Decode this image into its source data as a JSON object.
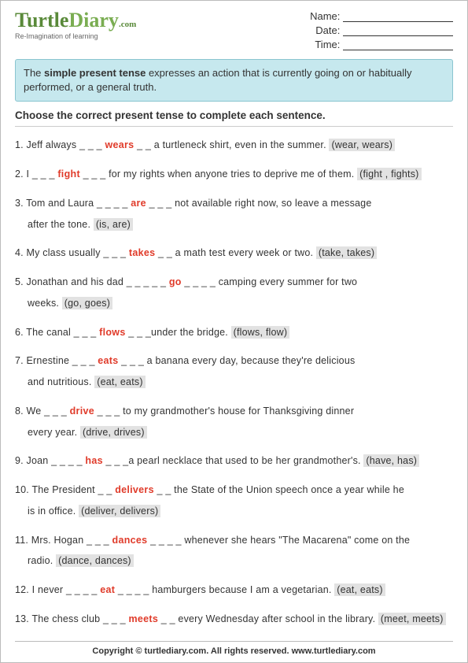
{
  "logo": {
    "main_a": "Turtle",
    "main_b": "Diary",
    "com": ".com",
    "tag": "Re-Imagination of learning"
  },
  "fields": {
    "name": "Name:",
    "date": "Date:",
    "time": "Time:"
  },
  "info": {
    "pre": "The ",
    "bold": "simple present tense",
    "post": " expresses an action that is currently going on or habitually performed, or a general truth."
  },
  "instr": "Choose the correct present tense to complete each sentence.",
  "q": [
    {
      "n": "1.",
      "a": "Jeff always _ _ _ ",
      "ans": "wears",
      "b": " _ _ a turtleneck shirt, even in the summer. ",
      "opt": "(wear, wears)"
    },
    {
      "n": "2.",
      "a": "I _ _ _ ",
      "ans": "fight",
      "b": " _ _ _ for my rights when anyone tries to deprive me of them. ",
      "opt": "(fight , fights)"
    },
    {
      "n": "3.",
      "a": "Tom and Laura _ _ _ _ ",
      "ans": "are",
      "b": " _ _ _ not available right now, so leave a message",
      "b2": "after the tone. ",
      "opt": "(is, are)"
    },
    {
      "n": "4.",
      "a": "My class usually _ _ _ ",
      "ans": "takes",
      "b": " _ _  a math test every week or two. ",
      "opt": "(take, takes)"
    },
    {
      "n": "5.",
      "a": "Jonathan and his dad _ _ _ _ _ ",
      "ans": "go",
      "b": " _ _ _ _  camping every summer for two",
      "b2": "weeks. ",
      "opt": "(go, goes)"
    },
    {
      "n": "6.",
      "a": "The canal _ _ _ ",
      "ans": "flows",
      "b": " _ _ _under the bridge. ",
      "opt": "(flows, flow)"
    },
    {
      "n": "7.",
      "a": "Ernestine _ _ _ ",
      "ans": "eats",
      "b": " _ _ _ a banana every day, because they're delicious",
      "b2": "and nutritious. ",
      "opt": "(eat, eats)"
    },
    {
      "n": "8.",
      "a": "We _ _ _ ",
      "ans": "drive",
      "b": " _ _ _ to my grandmother's house for Thanksgiving dinner",
      "b2": "every year. ",
      "opt": "(drive,  drives)"
    },
    {
      "n": "9.",
      "a": "Joan _ _ _ _ ",
      "ans": "has",
      "b": " _ _ _a pearl necklace that used to be her grandmother's. ",
      "opt": "(have, has)"
    },
    {
      "n": "10.",
      "a": "The President _ _ ",
      "ans": "delivers",
      "b": " _ _ the State of the Union speech once a year while he",
      "b2": "is in office. ",
      "opt": "(deliver,  delivers)"
    },
    {
      "n": "11.",
      "a": "Mrs. Hogan _ _ _ ",
      "ans": "dances",
      "b": " _ _ _ _  whenever she hears \"The Macarena\" come on the",
      "b2": "radio. ",
      "opt": "(dance, dances)"
    },
    {
      "n": "12.",
      "a": "I never _ _ _ _ ",
      "ans": "eat",
      "b": " _ _ _ _  hamburgers because I am a vegetarian. ",
      "opt": "(eat, eats)"
    },
    {
      "n": "13.",
      "a": "The chess club _ _ _ ",
      "ans": "meets",
      "b": " _ _ every Wednesday after school in the library. ",
      "opt": "(meet, meets)"
    }
  ],
  "ftr": "Copyright © turtlediary.com. All rights reserved.   www.turtlediary.com"
}
